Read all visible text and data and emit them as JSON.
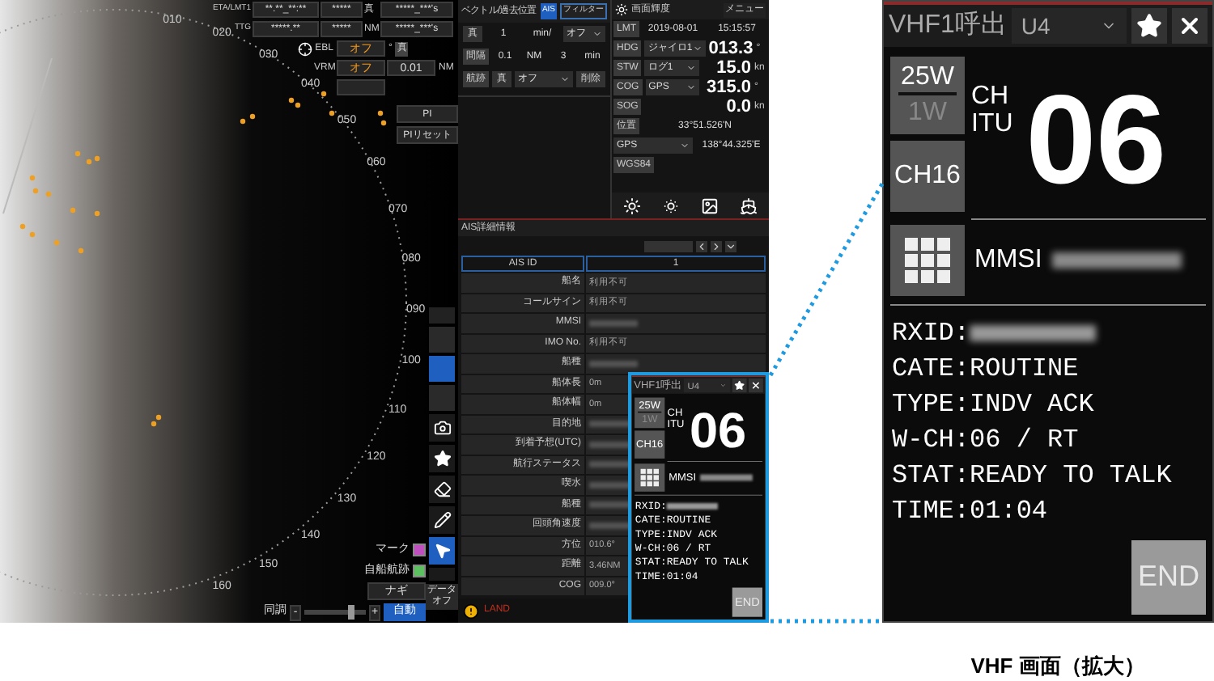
{
  "radar": {
    "bearing_labels": [
      "010",
      "020",
      "030",
      "040",
      "050",
      "060",
      "070",
      "080",
      "090",
      "100",
      "110",
      "120",
      "130",
      "140",
      "150",
      "160"
    ]
  },
  "target_info": {
    "rows": [
      {
        "label": "ETA/LMT1",
        "value_1": "**.**_**:**",
        "value_2": "*****",
        "unit": "真",
        "value_3": "*****_***'s"
      },
      {
        "label": "TTG",
        "value_1": "*****.**",
        "value_2": "*****",
        "unit": "NM",
        "value_3": "*****_***'s"
      }
    ],
    "ebl": {
      "label": "EBL",
      "value": "オフ",
      "unit_1": "°",
      "unit_2": "真"
    },
    "vrm": {
      "label": "VRM",
      "value": "オフ",
      "reading": "0.01",
      "unit": "NM"
    },
    "pi_buttons": [
      "PI",
      "PIリセット"
    ]
  },
  "radar_controls": {
    "legend": [
      {
        "label": "マーク",
        "color": "#c050c0"
      },
      {
        "label": "自船航跡",
        "color": "#5cc060"
      }
    ],
    "mode_button": "ナギ",
    "tune": {
      "label": "同調",
      "minus": "-",
      "plus": "+",
      "level": 0.75,
      "mode": "自動"
    }
  },
  "toolbar": {
    "tools": [
      {
        "kind": "camera",
        "selected": false
      },
      {
        "kind": "star",
        "selected": false
      },
      {
        "kind": "eraser",
        "selected": false
      },
      {
        "kind": "pencil",
        "selected": false
      },
      {
        "kind": "cursor",
        "selected": true
      }
    ],
    "data_button": {
      "line_1": "データ",
      "line_2": "オフ"
    }
  },
  "vector_panel": {
    "title": "ベクトル/過去位置",
    "tabs": [
      {
        "label": "AIS",
        "selected": true
      },
      {
        "label": "フィルター",
        "selected": false
      }
    ],
    "rows": [
      [
        {
          "kind": "button",
          "text": "真"
        },
        {
          "kind": "value",
          "text": "1"
        },
        {
          "kind": "value",
          "text": "min/"
        },
        {
          "kind": "dropdown",
          "text": "オフ"
        }
      ],
      [
        {
          "kind": "label",
          "text": "間隔"
        },
        {
          "kind": "value",
          "text": "0.1"
        },
        {
          "kind": "value",
          "text": "NM"
        },
        {
          "kind": "value",
          "text": "3"
        },
        {
          "kind": "value",
          "text": "min"
        }
      ],
      [
        {
          "kind": "label",
          "text": "航跡"
        },
        {
          "kind": "button",
          "text": "真"
        },
        {
          "kind": "dropdown",
          "text": "オフ"
        },
        {
          "kind": "button",
          "text": "削除"
        }
      ]
    ]
  },
  "sensor_panel": {
    "title": "画面輝度",
    "menu_button": "メニュー",
    "rows": [
      [
        {
          "kind": "label",
          "text": "LMT"
        },
        {
          "kind": "value",
          "text": "2019-08-01"
        },
        {
          "kind": "value",
          "text": "15:15:57"
        }
      ],
      [
        {
          "kind": "label",
          "text": "HDG"
        },
        {
          "kind": "dropdown",
          "text": "ジャイロ1"
        },
        {
          "kind": "big",
          "text": "013.3"
        },
        {
          "kind": "unit",
          "text": "°"
        }
      ],
      [
        {
          "kind": "label",
          "text": "STW"
        },
        {
          "kind": "dropdown",
          "text": "ログ1"
        },
        {
          "kind": "big",
          "text": "15.0"
        },
        {
          "kind": "unit",
          "text": "kn"
        }
      ],
      [
        {
          "kind": "label",
          "text": "COG"
        },
        {
          "kind": "dropdown",
          "text": "GPS"
        },
        {
          "kind": "big",
          "text": "315.0"
        },
        {
          "kind": "unit",
          "text": "°"
        }
      ],
      [
        {
          "kind": "label",
          "text": "SOG"
        },
        {
          "kind": "big",
          "text": "0.0"
        },
        {
          "kind": "unit",
          "text": "kn"
        }
      ],
      [
        {
          "kind": "label",
          "text": "位置"
        },
        {
          "kind": "value",
          "text": "33°51.526'N"
        }
      ],
      [
        {
          "kind": "dropdown",
          "text": "GPS"
        },
        {
          "kind": "value",
          "text": "138°44.325'E"
        }
      ],
      [
        {
          "kind": "label",
          "text": "WGS84"
        }
      ]
    ]
  },
  "ais_panel": {
    "title": "AIS詳細情報",
    "header": {
      "label": "AIS ID",
      "value": "1"
    },
    "rows": [
      {
        "label": "船名",
        "value": "利用不可"
      },
      {
        "label": "コールサイン",
        "value": "利用不可"
      },
      {
        "label": "MMSI"
      },
      {
        "label": "IMO No.",
        "value": "利用不可"
      },
      {
        "label": "船種"
      },
      {
        "label": "船体長",
        "value": "0m"
      },
      {
        "label": "船体幅",
        "value": "0m"
      },
      {
        "label": "目的地"
      },
      {
        "label": "到着予想(UTC)"
      },
      {
        "label": "航行ステータス"
      },
      {
        "label": "喫水"
      },
      {
        "label": "船種"
      },
      {
        "label": "回頭角速度"
      },
      {
        "label": "方位",
        "value": "010.6°"
      },
      {
        "label": "距離",
        "value": "3.46NM"
      },
      {
        "label": "COG",
        "value": "009.0°"
      }
    ]
  },
  "alert": {
    "text": "LAND"
  },
  "vhf_popup": {
    "title": "VHF1呼出",
    "unit": "U4",
    "power": [
      {
        "label": "25W",
        "selected": true
      },
      {
        "label": "1W",
        "selected": false
      }
    ],
    "ch16_button": "CH16",
    "ch_label": "CH",
    "itu_label": "ITU",
    "channel": "06",
    "mmsi_label": "MMSI",
    "rxid_label": "RXID:",
    "lines": [
      "CATE:ROUTINE",
      "TYPE:INDV ACK",
      "W-CH:06 / RT",
      "STAT:READY TO TALK",
      "TIME:01:04"
    ],
    "end_button": "END"
  },
  "vhf_enlarged": {
    "title": "VHF1呼出",
    "unit": "U4",
    "power": [
      {
        "label": "25W",
        "selected": true
      },
      {
        "label": "1W",
        "selected": false
      }
    ],
    "ch16_button": "CH16",
    "ch_label": "CH",
    "itu_label": "ITU",
    "channel": "06",
    "mmsi_label": "MMSI",
    "rxid_label": "RXID:",
    "lines": [
      "CATE:ROUTINE",
      "TYPE:INDV ACK",
      "W-CH:06 / RT",
      "STAT:READY TO TALK",
      "TIME:01:04"
    ],
    "end_button": "END"
  },
  "caption": "VHF 画面（拡大）"
}
